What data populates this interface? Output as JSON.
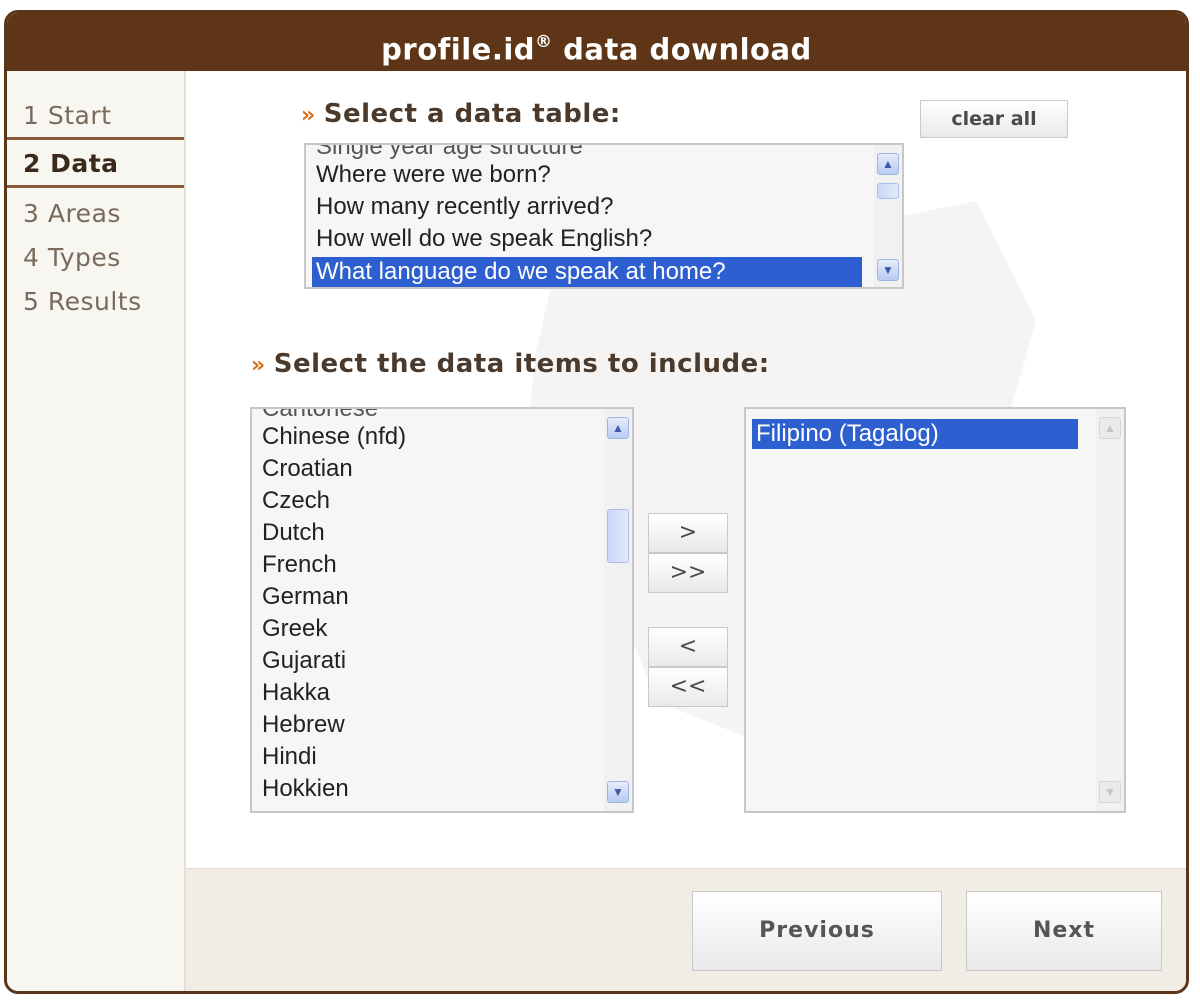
{
  "window": {
    "title_main": "profile.id",
    "title_reg": "®",
    "title_rest": " data download"
  },
  "steps": [
    {
      "label": "1 Start"
    },
    {
      "label": "2 Data"
    },
    {
      "label": "3 Areas"
    },
    {
      "label": "4 Types"
    },
    {
      "label": "5 Results"
    }
  ],
  "table_section": {
    "heading_marker": "»",
    "heading": "Select a data table:",
    "clear_all": "clear all",
    "partial_top_item": "Single year age structure",
    "options": [
      "Where were we born?",
      "How many recently arrived?",
      "How well do we speak English?",
      "What language do we speak at home?"
    ],
    "selected": "What language do we speak at home?"
  },
  "items_section": {
    "heading_marker": "»",
    "heading": "Select the data items to include:",
    "partial_top_item": "Cantonese",
    "available": [
      "Chinese (nfd)",
      "Croatian",
      "Czech",
      "Dutch",
      "French",
      "German",
      "Greek",
      "Gujarati",
      "Hakka",
      "Hebrew",
      "Hindi",
      "Hokkien"
    ],
    "selected_items": [
      "Filipino (Tagalog)"
    ],
    "buttons": {
      "add": ">",
      "add_all": ">>",
      "remove": "<",
      "remove_all": "<<"
    }
  },
  "footer": {
    "previous": "Previous",
    "next": "Next"
  },
  "colors": {
    "brand_brown": "#5e3516",
    "selection_blue": "#2d5fd0",
    "accent_orange": "#d4701e"
  }
}
